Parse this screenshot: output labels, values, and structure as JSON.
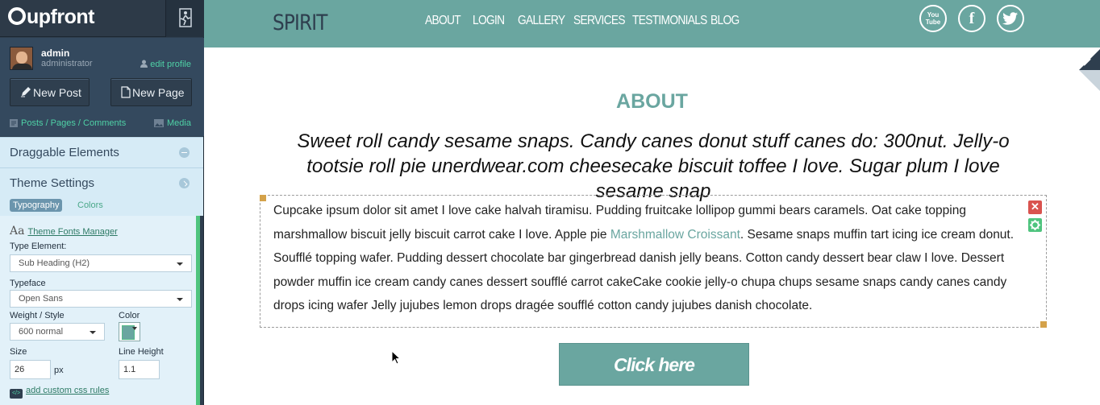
{
  "sidebar": {
    "brand": "upfront",
    "user": {
      "name": "admin",
      "role": "administrator",
      "edit_profile": "edit profile"
    },
    "buttons": {
      "new_post": "New Post",
      "new_page": "New Page"
    },
    "links": {
      "posts": "Posts / Pages / Comments",
      "media": "Media"
    },
    "sections": {
      "draggable": "Draggable Elements",
      "theme_settings": "Theme Settings"
    },
    "tabs": {
      "typography": "Typography",
      "colors": "Colors"
    },
    "typography": {
      "fonts_manager": "Theme Fonts Manager",
      "type_element_label": "Type Element:",
      "type_element_value": "Sub Heading (H2)",
      "typeface_label": "Typeface",
      "typeface_value": "Open Sans",
      "weight_label": "Weight / Style",
      "weight_value": "600 normal",
      "color_label": "Color",
      "size_label": "Size",
      "size_value": "26",
      "size_unit": "px",
      "line_height_label": "Line Height",
      "line_height_value": "1.1",
      "add_css": "add custom css rules"
    }
  },
  "site": {
    "brand": "SPIRIT",
    "nav": [
      "ABOUT",
      "LOGIN",
      "GALLERY",
      "SERVICES",
      "TESTIMONIALS",
      "BLOG"
    ],
    "social": {
      "youtube": "You Tube",
      "facebook": "f"
    },
    "heading": "ABOUT",
    "subheading": "Sweet roll candy sesame snaps. Candy canes donut stuff canes do: 300nut. Jelly-o tootsie roll pie unerdwear.com cheesecake biscuit toffee I love. Sugar plum I love sesame snap",
    "body_before_link": "Cupcake ipsum dolor sit amet I love cake halvah tiramisu. Pudding fruitcake lollipop gummi bears caramels. Oat cake topping marshmallow biscuit jelly biscuit carrot cake I love. Apple pie ",
    "body_link": "Marshmallow Croissant",
    "body_after_link": ". Sesame snaps muffin tart icing ice cream donut. Soufflé topping wafer. Pudding dessert chocolate bar gingerbread danish jelly beans. Cotton candy dessert bear claw I love. Dessert powder muffin ice cream candy canes dessert soufflé carrot cakeCake cookie jelly-o chupa chups sesame snaps candy canes candy drops icing wafer Jelly jujubes lemon drops dragée soufflé cotton candy jujubes danish chocolate.",
    "close_glyph": "✕",
    "cta": "Click here"
  },
  "colors": {
    "accent": "#6aa6a0",
    "sidebar": "#34495e",
    "link_green": "#4fd1a6"
  }
}
